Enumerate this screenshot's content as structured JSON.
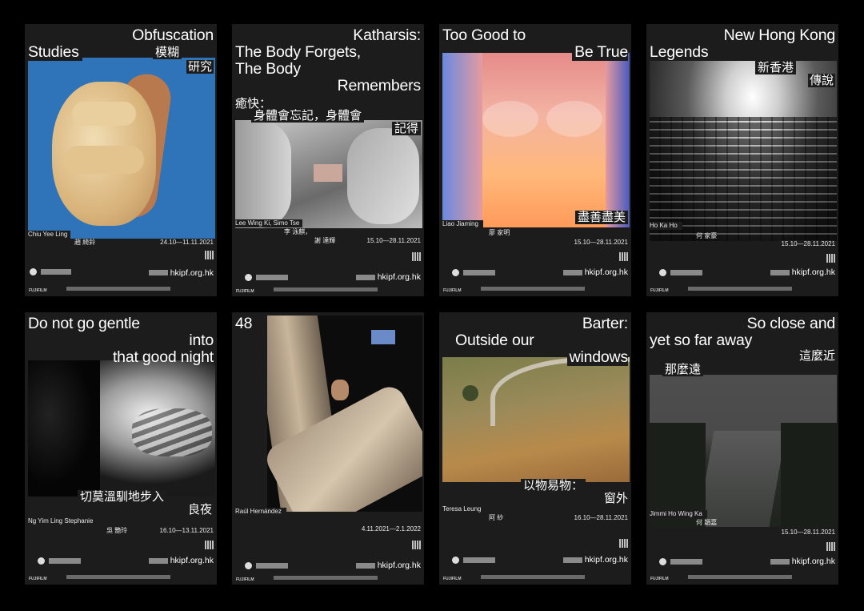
{
  "posters": [
    {
      "title": [
        "Obfuscation",
        "Studies"
      ],
      "title_cn": [
        "模糊",
        "研究"
      ],
      "artist": "Chiu Yee Ling",
      "artist_cn": "趙 綺鈴",
      "dates": "24.10—11.11.2021",
      "url": "hkipf.org.hk"
    },
    {
      "title": [
        "Katharsis:",
        "The Body Forgets,",
        "The Body",
        "Remembers"
      ],
      "title_cn": [
        "癒快：",
        "身體會忘記，身體會",
        "記得"
      ],
      "artist": "Lee Wing Ki, Simo Tse",
      "artist_cn": "李 泳麒，",
      "artist_cn2": "謝 達輝",
      "dates": "15.10—28.11.2021",
      "url": "hkipf.org.hk"
    },
    {
      "title": [
        "Too Good to",
        "Be True"
      ],
      "title_cn": [
        "盡善盡美"
      ],
      "artist": "Liao Jiaming",
      "artist_cn": "廖 家明",
      "dates": "15.10—28.11.2021",
      "url": "hkipf.org.hk"
    },
    {
      "title": [
        "New Hong Kong",
        "Legends"
      ],
      "title_cn": [
        "新香港",
        "傳說"
      ],
      "artist": "Ho Ka Ho",
      "artist_cn": "何 家豪",
      "dates": "15.10—28.11.2021",
      "url": "hkipf.org.hk"
    },
    {
      "title": [
        "Do not go gentle",
        "into",
        "that good night"
      ],
      "title_cn": [
        "切莫溫馴地步入",
        "良夜"
      ],
      "artist": "Ng Yim Ling Stephanie",
      "artist_cn": "吳 艷玲",
      "dates": "16.10—13.11.2021",
      "url": "hkipf.org.hk"
    },
    {
      "title": [
        "48"
      ],
      "artist": "Raúl Hernández",
      "dates": "4.11.2021—2.1.2022",
      "url": "hkipf.org.hk"
    },
    {
      "title": [
        "Barter:",
        "Outside our",
        "windows"
      ],
      "title_cn": [
        "以物易物：",
        "窗外"
      ],
      "artist": "Teresa Leung",
      "artist_cn": "阿 紗",
      "dates": "16.10—28.11.2021",
      "url": "hkipf.org.hk"
    },
    {
      "title": [
        "So close and",
        "yet so far away"
      ],
      "title_cn": [
        "這麼近",
        "那麼遠"
      ],
      "artist": "Jimmi Ho Wing Ka",
      "artist_cn": "何 穎嘉",
      "dates": "15.10—28.11.2021",
      "url": "hkipf.org.hk"
    }
  ],
  "sponsor": "FUJIFILM"
}
